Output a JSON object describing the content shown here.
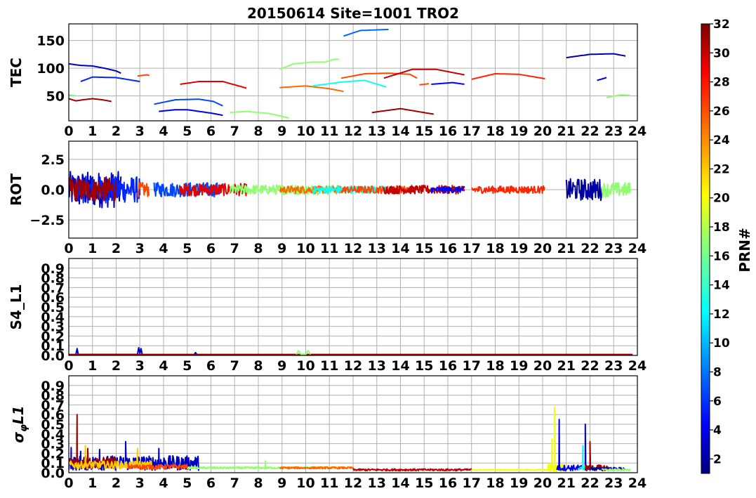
{
  "chart_data": {
    "type": "line",
    "title": "20150614 Site=1001 TRO2",
    "x_ticks": [
      0,
      1,
      2,
      3,
      4,
      5,
      6,
      7,
      8,
      9,
      10,
      11,
      12,
      13,
      14,
      15,
      16,
      17,
      18,
      19,
      20,
      21,
      22,
      23,
      24
    ],
    "xlim": [
      0,
      24
    ],
    "grid": true,
    "colorbar": {
      "label": "PRN#",
      "range": [
        1,
        32
      ],
      "ticks": [
        2,
        4,
        6,
        8,
        10,
        12,
        14,
        16,
        18,
        20,
        22,
        24,
        26,
        28,
        30,
        32
      ],
      "colormap": "jet"
    },
    "panels": [
      {
        "ylabel": "TEC",
        "ylim": [
          5,
          180
        ],
        "yticks": [
          50,
          100,
          150
        ],
        "ytick_labels": [
          "50",
          "100",
          "150"
        ],
        "series": [
          {
            "prn": 31,
            "points": [
              [
                0,
                45
              ],
              [
                0.3,
                41
              ],
              [
                0.6,
                43
              ],
              [
                1,
                45
              ],
              [
                1.4,
                43
              ],
              [
                1.8,
                40
              ]
            ]
          },
          {
            "prn": 16,
            "points": [
              [
                0,
                52
              ],
              [
                0.3,
                50
              ]
            ]
          },
          {
            "prn": 3,
            "points": [
              [
                0,
                108
              ],
              [
                0.5,
                105
              ],
              [
                1,
                104
              ],
              [
                1.5,
                100
              ],
              [
                2,
                95
              ],
              [
                2.2,
                91
              ]
            ]
          },
          {
            "prn": 6,
            "points": [
              [
                0.5,
                76
              ],
              [
                1,
                84
              ],
              [
                2,
                83
              ],
              [
                3,
                76
              ]
            ]
          },
          {
            "prn": 26,
            "points": [
              [
                2.9,
                86
              ],
              [
                3.3,
                88
              ],
              [
                3.4,
                87
              ]
            ]
          },
          {
            "prn": 7,
            "points": [
              [
                3.6,
                35
              ],
              [
                4.5,
                43
              ],
              [
                5.5,
                44
              ],
              [
                6.1,
                40
              ],
              [
                6.5,
                32
              ]
            ]
          },
          {
            "prn": 4,
            "points": [
              [
                3.8,
                22
              ],
              [
                4.5,
                25
              ],
              [
                5,
                25
              ],
              [
                6,
                19
              ],
              [
                6.5,
                15
              ]
            ]
          },
          {
            "prn": 29,
            "points": [
              [
                4.7,
                71
              ],
              [
                5.5,
                76
              ],
              [
                6.5,
                76
              ],
              [
                7.5,
                64
              ]
            ]
          },
          {
            "prn": 17,
            "points": [
              [
                6.8,
                20
              ],
              [
                7.5,
                22
              ],
              [
                8.5,
                18
              ],
              [
                9.3,
                10
              ]
            ]
          },
          {
            "prn": 17,
            "points": [
              [
                8.9,
                98
              ],
              [
                9.5,
                108
              ],
              [
                10.3,
                111
              ],
              [
                10.8,
                111
              ],
              [
                11.2,
                116
              ],
              [
                11.4,
                116
              ]
            ]
          },
          {
            "prn": 25,
            "points": [
              [
                8.9,
                65
              ],
              [
                10,
                68
              ],
              [
                11,
                63
              ],
              [
                11.6,
                58
              ]
            ]
          },
          {
            "prn": 13,
            "points": [
              [
                10.3,
                68
              ],
              [
                11.5,
                75
              ],
              [
                12.5,
                78
              ],
              [
                13.4,
                66
              ]
            ]
          },
          {
            "prn": 26,
            "points": [
              [
                11.5,
                82
              ],
              [
                12.5,
                90
              ],
              [
                13.5,
                91
              ],
              [
                14.4,
                89
              ],
              [
                14.7,
                82
              ]
            ]
          },
          {
            "prn": 30,
            "points": [
              [
                13.3,
                82
              ],
              [
                14.5,
                98
              ],
              [
                15.5,
                98
              ],
              [
                16.7,
                88
              ]
            ]
          },
          {
            "prn": 8,
            "points": [
              [
                11.6,
                158
              ],
              [
                12.3,
                168
              ],
              [
                13.5,
                170
              ]
            ]
          },
          {
            "prn": 31,
            "points": [
              [
                12.8,
                20
              ],
              [
                14,
                27
              ],
              [
                15.4,
                17
              ]
            ]
          },
          {
            "prn": 26,
            "points": [
              [
                14.8,
                70
              ],
              [
                15.2,
                72
              ]
            ]
          },
          {
            "prn": 5,
            "points": [
              [
                15.3,
                71
              ],
              [
                16.2,
                74
              ],
              [
                16.7,
                71
              ]
            ]
          },
          {
            "prn": 27,
            "points": [
              [
                17,
                80
              ],
              [
                18,
                90
              ],
              [
                19,
                89
              ],
              [
                20.1,
                81
              ]
            ]
          },
          {
            "prn": 2,
            "points": [
              [
                21,
                119
              ],
              [
                22,
                125
              ],
              [
                23,
                126
              ],
              [
                23.5,
                122
              ]
            ]
          },
          {
            "prn": 4,
            "points": [
              [
                22.3,
                78
              ],
              [
                22.7,
                83
              ]
            ]
          },
          {
            "prn": 17,
            "points": [
              [
                22.7,
                47
              ],
              [
                23.3,
                52
              ],
              [
                23.7,
                51
              ]
            ]
          }
        ]
      },
      {
        "ylabel": "ROT",
        "ylim": [
          -4,
          4
        ],
        "yticks": [
          -2.5,
          0,
          2.5
        ],
        "ytick_labels": [
          "−2.5",
          "0.0",
          "2.5"
        ],
        "series": [
          {
            "prn": 3,
            "x_range": [
              0,
              2.2
            ],
            "amp": 1.5
          },
          {
            "prn": 6,
            "x_range": [
              0.3,
              3.0
            ],
            "amp": 1.1
          },
          {
            "prn": 31,
            "x_range": [
              0,
              2.0
            ],
            "amp": 1.0
          },
          {
            "prn": 26,
            "x_range": [
              2.9,
              3.4
            ],
            "amp": 0.6
          },
          {
            "prn": 7,
            "x_range": [
              3.6,
              6.5
            ],
            "amp": 0.6
          },
          {
            "prn": 29,
            "x_range": [
              4.7,
              7.5
            ],
            "amp": 0.5
          },
          {
            "prn": 17,
            "x_range": [
              6.8,
              9.3
            ],
            "amp": 0.4
          },
          {
            "prn": 17,
            "x_range": [
              8.9,
              11.4
            ],
            "amp": 0.4
          },
          {
            "prn": 25,
            "x_range": [
              8.9,
              11.6
            ],
            "amp": 0.3
          },
          {
            "prn": 13,
            "x_range": [
              10.3,
              13.4
            ],
            "amp": 0.3
          },
          {
            "prn": 26,
            "x_range": [
              11.5,
              14.7
            ],
            "amp": 0.3
          },
          {
            "prn": 30,
            "x_range": [
              13.3,
              16.7
            ],
            "amp": 0.35
          },
          {
            "prn": 5,
            "x_range": [
              15.3,
              16.7
            ],
            "amp": 0.25
          },
          {
            "prn": 27,
            "x_range": [
              17,
              20.1
            ],
            "amp": 0.3
          },
          {
            "prn": 2,
            "x_range": [
              21,
              22.5
            ],
            "amp": 0.9
          },
          {
            "prn": 17,
            "x_range": [
              22.5,
              23.7
            ],
            "amp": 0.6
          }
        ]
      },
      {
        "ylabel": "S4_L1",
        "ylim": [
          0,
          1
        ],
        "yticks": [
          0,
          0.1,
          0.2,
          0.3,
          0.4,
          0.5,
          0.6,
          0.7,
          0.8,
          0.9
        ],
        "ytick_labels": [
          "0.0",
          "0.1",
          "0.2",
          "0.3",
          "0.4",
          "0.5",
          "0.6",
          "0.7",
          "0.8",
          "0.9"
        ],
        "series": [
          {
            "prn": 3,
            "points": [
              [
                0.3,
                0.01
              ],
              [
                0.35,
                0.07
              ],
              [
                0.4,
                0.01
              ],
              [
                2.9,
                0.01
              ],
              [
                2.95,
                0.08
              ],
              [
                3.0,
                0.02
              ],
              [
                3.05,
                0.07
              ],
              [
                3.1,
                0.01
              ]
            ]
          },
          {
            "prn": 31,
            "points": [
              [
                0,
                0.01
              ],
              [
                23.8,
                0.01
              ]
            ]
          },
          {
            "prn": 17,
            "points": [
              [
                9.6,
                0.01
              ],
              [
                9.7,
                0.05
              ],
              [
                9.8,
                0.01
              ],
              [
                10.0,
                0.01
              ],
              [
                10.1,
                0.05
              ],
              [
                10.2,
                0.01
              ]
            ]
          },
          {
            "prn": 4,
            "points": [
              [
                5.3,
                0.01
              ],
              [
                5.35,
                0.03
              ],
              [
                5.4,
                0.01
              ]
            ]
          }
        ]
      },
      {
        "ylabel": "σφL1",
        "ylim": [
          0,
          1
        ],
        "yticks": [
          0,
          0.1,
          0.2,
          0.3,
          0.4,
          0.5,
          0.6,
          0.7,
          0.8,
          0.9
        ],
        "ytick_labels": [
          "0.0",
          "0.1",
          "0.2",
          "0.3",
          "0.4",
          "0.5",
          "0.6",
          "0.7",
          "0.8",
          "0.9"
        ],
        "series": [
          {
            "prn": 3,
            "x_range": [
              0,
              5.5
            ],
            "base": 0.1,
            "amp": 0.15,
            "spikes": [
              [
                0.1,
                0.26
              ],
              [
                0.5,
                0.22
              ],
              [
                1.3,
                0.24
              ],
              [
                2.4,
                0.32
              ],
              [
                3.8,
                0.25
              ]
            ]
          },
          {
            "prn": 31,
            "x_range": [
              0,
              2.0
            ],
            "base": 0.1,
            "amp": 0.12,
            "spikes": [
              [
                0.35,
                0.6
              ],
              [
                0.8,
                0.25
              ]
            ]
          },
          {
            "prn": 22,
            "x_range": [
              0,
              3.5
            ],
            "base": 0.08,
            "amp": 0.08,
            "spikes": [
              [
                0.7,
                0.28
              ],
              [
                2.9,
                0.25
              ]
            ]
          },
          {
            "prn": 26,
            "x_range": [
              2.5,
              5.0
            ],
            "base": 0.06,
            "amp": 0.05,
            "spikes": []
          },
          {
            "prn": 17,
            "x_range": [
              5,
              11.5
            ],
            "base": 0.05,
            "amp": 0.02,
            "spikes": [
              [
                8.3,
                0.12
              ]
            ]
          },
          {
            "prn": 25,
            "x_range": [
              8.9,
              12
            ],
            "base": 0.05,
            "amp": 0.02,
            "spikes": []
          },
          {
            "prn": 30,
            "x_range": [
              12,
              17
            ],
            "base": 0.03,
            "amp": 0.02,
            "spikes": []
          },
          {
            "prn": 20,
            "x_range": [
              17,
              20.3
            ],
            "base": 0.03,
            "amp": 0.01,
            "spikes": []
          },
          {
            "prn": 20,
            "x_range": [
              20.2,
              20.9
            ],
            "base": 0.05,
            "amp": 0.1,
            "spikes": [
              [
                20.5,
                0.68
              ],
              [
                20.4,
                0.35
              ]
            ]
          },
          {
            "prn": 4,
            "x_range": [
              20.6,
              22.0
            ],
            "base": 0.05,
            "amp": 0.06,
            "spikes": [
              [
                20.7,
                0.55
              ],
              [
                21.8,
                0.5
              ]
            ]
          },
          {
            "prn": 13,
            "x_range": [
              21.5,
              22.2
            ],
            "base": 0.05,
            "amp": 0.05,
            "spikes": [
              [
                21.7,
                0.28
              ]
            ]
          },
          {
            "prn": 31,
            "x_range": [
              21.8,
              22.8
            ],
            "base": 0.05,
            "amp": 0.06,
            "spikes": [
              [
                22.0,
                0.32
              ]
            ]
          },
          {
            "prn": 2,
            "x_range": [
              22.0,
              23.5
            ],
            "base": 0.04,
            "amp": 0.03,
            "spikes": []
          },
          {
            "prn": 17,
            "x_range": [
              22.5,
              23.7
            ],
            "base": 0.03,
            "amp": 0.02,
            "spikes": []
          }
        ]
      }
    ]
  }
}
